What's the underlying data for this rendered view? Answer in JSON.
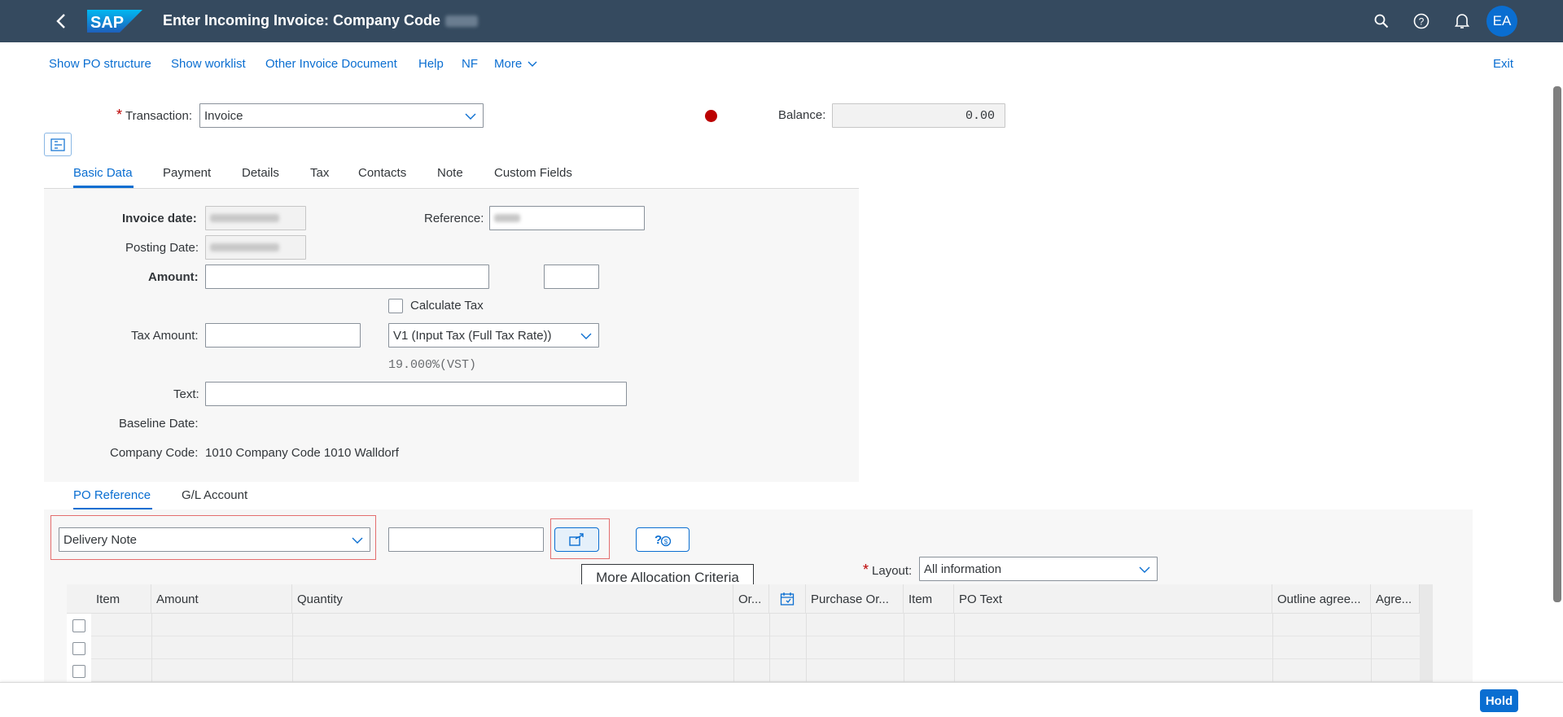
{
  "shell": {
    "title": "Enter Incoming Invoice: Company Code",
    "avatar_initials": "EA",
    "icons": [
      "back-icon",
      "search-icon",
      "help-icon",
      "notification-icon"
    ]
  },
  "toolbar": {
    "show_po_structure": "Show PO structure",
    "show_worklist": "Show worklist",
    "other_invoice_document": "Other Invoice Document",
    "help": "Help",
    "nf": "NF",
    "more": "More",
    "exit": "Exit"
  },
  "header": {
    "transaction_label": "Transaction:",
    "transaction_value": "Invoice",
    "balance_label": "Balance:",
    "balance_value": "0.00",
    "status_color": "#bb0000"
  },
  "tabs": [
    "Basic Data",
    "Payment",
    "Details",
    "Tax",
    "Contacts",
    "Note",
    "Custom Fields"
  ],
  "basic_data": {
    "invoice_date_label": "Invoice date:",
    "posting_date_label": "Posting Date:",
    "reference_label": "Reference:",
    "amount_label": "Amount:",
    "calculate_tax_label": "Calculate Tax",
    "tax_amount_label": "Tax Amount:",
    "tax_code_value": "V1 (Input Tax (Full Tax Rate))",
    "tax_rate_text": "19.000%(VST)",
    "text_label": "Text:",
    "baseline_date_label": "Baseline Date:",
    "company_code_label": "Company Code:",
    "company_code_value": "1010 Company Code 1010 Walldorf"
  },
  "lower_tabs": [
    "PO Reference",
    "G/L Account"
  ],
  "po_reference": {
    "reference_type": "Delivery Note",
    "tooltip": "More Allocation Criteria",
    "layout_label": "Layout:",
    "layout_value": "All information"
  },
  "table": {
    "columns": [
      "Item",
      "Amount",
      "Quantity",
      "Or...",
      "",
      "Purchase Or...",
      "Item",
      "PO Text",
      "Outline agree...",
      "Agre..."
    ]
  },
  "footer": {
    "hold_label": "Hold"
  }
}
